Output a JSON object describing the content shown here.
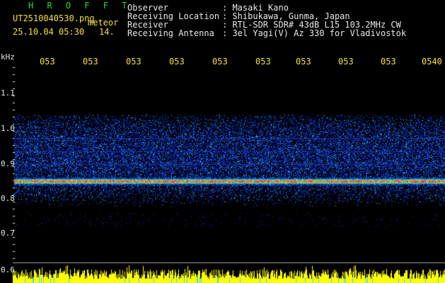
{
  "header": {
    "app_name": "H R O F F T",
    "filename": "UT2510040530.png",
    "event_type": "meteor",
    "datetime": "25.10.04 05:30",
    "count": "14.",
    "info_labels": [
      "Observer",
      "Receiving Location",
      "Receiver",
      "Receiving Antenna"
    ],
    "info_values": [
      ": Masaki Kano",
      ": Shibukawa, Gunma, Japan",
      ": RTL-SDR SDR# 43dB L15 103.2MHz CW",
      ": 3el Yagi(V) Az 330 for Vladivostok"
    ]
  },
  "axis": {
    "unit": "kHz",
    "x_ticks": [
      "053",
      "053",
      "053",
      "053",
      "053",
      "053",
      "053",
      "053",
      "053",
      "0540"
    ],
    "y_ticks": [
      "1.1",
      "1.0",
      "0.9",
      "0.8",
      "0.7",
      "0.6"
    ]
  },
  "colors": {
    "background": "#000000",
    "green_title": "#22dd22",
    "yellow_text": "#f0e040",
    "signal_line": "#ff3030",
    "noise_blue": "#1030c0",
    "bars_yellow": "#ffff00",
    "bars_cyan": "#30e0ff"
  }
}
